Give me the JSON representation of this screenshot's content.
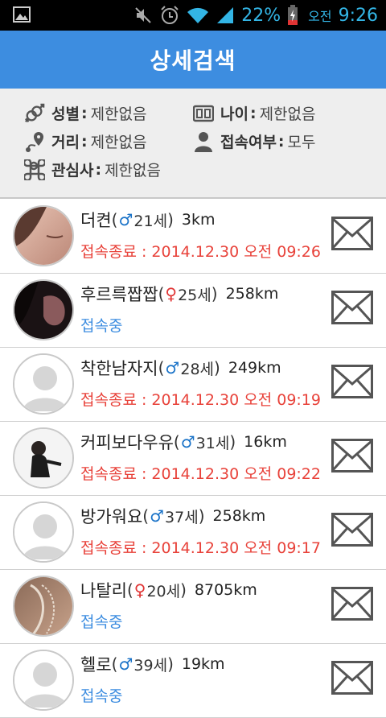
{
  "status_bar": {
    "battery_percent": "22%",
    "ampm": "오전",
    "time": "9:26"
  },
  "title": "상세검색",
  "filters": {
    "gender": {
      "label": "성별",
      "value": "제한없음"
    },
    "age": {
      "label": "나이",
      "value": "제한없음"
    },
    "distance": {
      "label": "거리",
      "value": "제한없음"
    },
    "online": {
      "label": "접속여부",
      "value": "모두"
    },
    "interest": {
      "label": "관심사",
      "value": "제한없음"
    }
  },
  "colon": ":",
  "users": [
    {
      "nick": "더켠",
      "gender": "male",
      "gender_symbol": "♂",
      "age": "21세",
      "distance": "3km",
      "status": "접속종료 : 2014.12.30 오전 09:26",
      "online": false,
      "avatar": "face-photo"
    },
    {
      "nick": "후르륵짭짭",
      "gender": "female",
      "gender_symbol": "♀",
      "age": "25세",
      "distance": "258km",
      "status": "접속중",
      "online": true,
      "avatar": "dark-photo"
    },
    {
      "nick": "착한남자지",
      "gender": "male",
      "gender_symbol": "♂",
      "age": "28세",
      "distance": "249km",
      "status": "접속종료 : 2014.12.30 오전 09:19",
      "online": false,
      "avatar": "default"
    },
    {
      "nick": "커피보다우유",
      "gender": "male",
      "gender_symbol": "♂",
      "age": "31세",
      "distance": "16km",
      "status": "접속종료 : 2014.12.30 오전 09:22",
      "online": false,
      "avatar": "person-photo"
    },
    {
      "nick": "방가워요",
      "gender": "male",
      "gender_symbol": "♂",
      "age": "37세",
      "distance": "258km",
      "status": "접속종료 : 2014.12.30 오전 09:17",
      "online": false,
      "avatar": "default"
    },
    {
      "nick": "나탈리",
      "gender": "female",
      "gender_symbol": "♀",
      "age": "20세",
      "distance": "8705km",
      "status": "접속중",
      "online": true,
      "avatar": "lace-photo"
    },
    {
      "nick": "헬로",
      "gender": "male",
      "gender_symbol": "♂",
      "age": "39세",
      "distance": "19km",
      "status": "접속중",
      "online": true,
      "avatar": "default"
    }
  ],
  "colors": {
    "title_bar": "#3d8de0",
    "status_offline": "#e8423a",
    "status_online": "#3d8de0",
    "male": "#1a73c8",
    "female": "#e03434"
  }
}
